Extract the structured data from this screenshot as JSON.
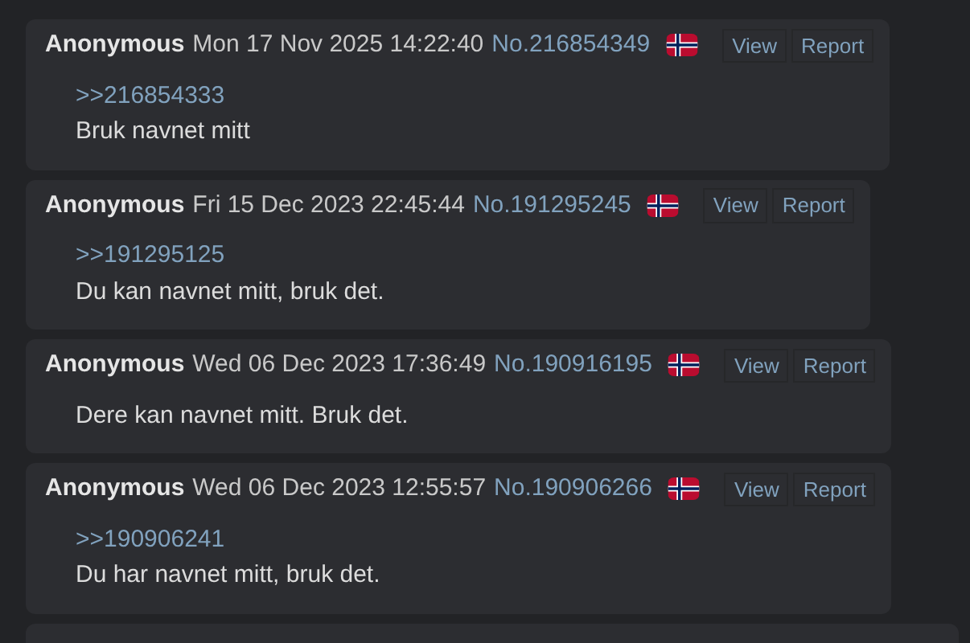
{
  "posts": [
    {
      "name": "Anonymous",
      "date": "Mon 17 Nov 2025 14:22:40",
      "number": "No.216854349",
      "buttons": [
        "View",
        "Report"
      ],
      "quote": ">>216854333",
      "text": "Bruk navnet mitt"
    },
    {
      "name": "Anonymous",
      "date": "Fri 15 Dec 2023 22:45:44",
      "number": "No.191295245",
      "buttons": [
        "View",
        "Report"
      ],
      "quote": ">>191295125",
      "text": "Du kan navnet mitt, bruk det."
    },
    {
      "name": "Anonymous",
      "date": "Wed 06 Dec 2023 17:36:49",
      "number": "No.190916195",
      "buttons": [
        "View",
        "Report"
      ],
      "text": "Dere kan navnet mitt. Bruk det."
    },
    {
      "name": "Anonymous",
      "date": "Wed 06 Dec 2023 12:55:57",
      "number": "No.190906266",
      "buttons": [
        "View",
        "Report"
      ],
      "quote": ">>190906241",
      "text": "Du har navnet mitt, bruk det."
    }
  ]
}
